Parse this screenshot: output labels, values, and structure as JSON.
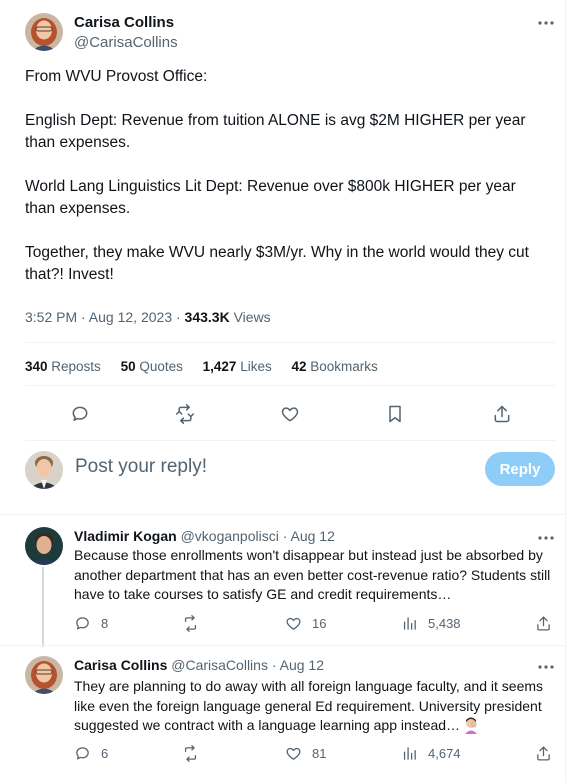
{
  "main_tweet": {
    "author_name": "Carisa Collins",
    "author_handle": "@CarisaCollins",
    "more_icon": "more-horizontal-icon",
    "paragraphs": [
      "From WVU Provost Office:",
      "English Dept: Revenue from tuition ALONE is avg $2M HIGHER per year than expenses.",
      "World Lang Linguistics Lit Dept: Revenue over $800k HIGHER per year than expenses.",
      "Together, they make WVU nearly $3M/yr. Why in the world would they cut that?! Invest!"
    ],
    "timestamp": "3:52 PM · Aug 12, 2023 · ",
    "views_count": "343.3K",
    "views_label": " Views",
    "stats": {
      "reposts_count": "340",
      "reposts_label": " Reposts",
      "quotes_count": "50",
      "quotes_label": " Quotes",
      "likes_count": "1,427",
      "likes_label": " Likes",
      "bookmarks_count": "42",
      "bookmarks_label": " Bookmarks"
    },
    "actions": [
      "reply-icon",
      "repost-icon",
      "like-icon",
      "bookmark-icon",
      "share-icon"
    ]
  },
  "composer": {
    "placeholder": "Post your reply!",
    "button_label": "Reply"
  },
  "replies": [
    {
      "name": "Vladimir Kogan",
      "handle_date": " @vkoganpolisci · Aug 12",
      "text": "Because those enrollments won't disappear but instead just be absorbed by another department that has an even better cost-revenue ratio? Students still have to take courses to satisfy GE and credit requirements…",
      "replies": "8",
      "reposts": "",
      "likes": "16",
      "views": "5,438"
    },
    {
      "name": "Carisa Collins",
      "handle_date": " @CarisaCollins · Aug 12",
      "text": "They are planning to do away with all foreign language faculty, and it seems like even the foreign language general Ed requirement. University president suggested we contract with a language learning app instead…",
      "replies": "6",
      "reposts": "",
      "likes": "81",
      "views": "4,674"
    }
  ],
  "colors": {
    "text": "#0f1419",
    "secondary": "#536471",
    "reply_button": "#8ecdf8",
    "divider": "#eff3f4"
  }
}
